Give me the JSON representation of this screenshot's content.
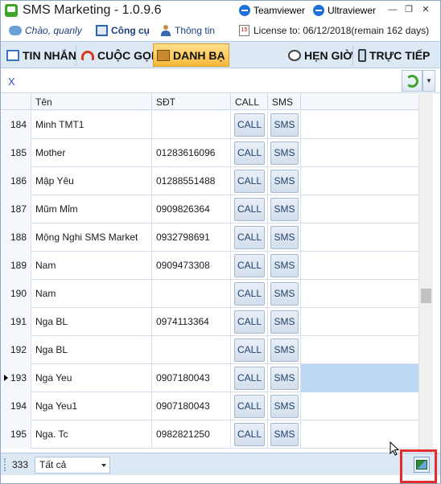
{
  "titlebar": {
    "title": "SMS Marketing - 1.0.9.6",
    "teamviewer": "Teamviewer",
    "ultraviewer": "Ultraviewer",
    "minimize": "—",
    "restore": "❐",
    "close": "✕"
  },
  "info": {
    "greeting": "Chào, quanly",
    "tools": "Công cụ",
    "info": "Thông tin",
    "license": "License to: 06/12/2018(remain 162 days)",
    "cal_day": "15"
  },
  "tabs": {
    "messages": "TIN NHẮN",
    "calls": "CUỘC GỌI",
    "contacts": "DANH BẠ",
    "schedule": "HẸN GIỜ",
    "online": "TRỰC TIẾP"
  },
  "search": {
    "value": "X"
  },
  "grid": {
    "headers": {
      "name": "Tên",
      "phone": "SĐT",
      "call": "CALL",
      "sms": "SMS"
    },
    "call_label": "CALL",
    "sms_label": "SMS",
    "rows": [
      {
        "idx": "184",
        "name": "Minh TMT1",
        "phone": ""
      },
      {
        "idx": "185",
        "name": "Mother",
        "phone": "01283616096"
      },
      {
        "idx": "186",
        "name": "Mập Yêu",
        "phone": "01288551488"
      },
      {
        "idx": "187",
        "name": "Mũm Mỉm",
        "phone": "0909826364"
      },
      {
        "idx": "188",
        "name": "Mộng Nghi SMS Market",
        "phone": "0932798691"
      },
      {
        "idx": "189",
        "name": "Nam",
        "phone": "0909473308"
      },
      {
        "idx": "190",
        "name": "Nam",
        "phone": ""
      },
      {
        "idx": "191",
        "name": "Nga BL",
        "phone": "0974113364"
      },
      {
        "idx": "192",
        "name": "Nga BL",
        "phone": ""
      },
      {
        "idx": "193",
        "name": "Nga Yeu",
        "phone": "0907180043"
      },
      {
        "idx": "194",
        "name": "Nga Yeu1",
        "phone": "0907180043"
      },
      {
        "idx": "195",
        "name": "Nga. Tc",
        "phone": "0982821250"
      }
    ],
    "selected_index": 9
  },
  "status": {
    "count": "333",
    "filter": "Tất cả"
  },
  "colors": {
    "selection": "#bcd8f5",
    "highlight": "#e52b2b",
    "active_tab": "#f8b93c"
  }
}
